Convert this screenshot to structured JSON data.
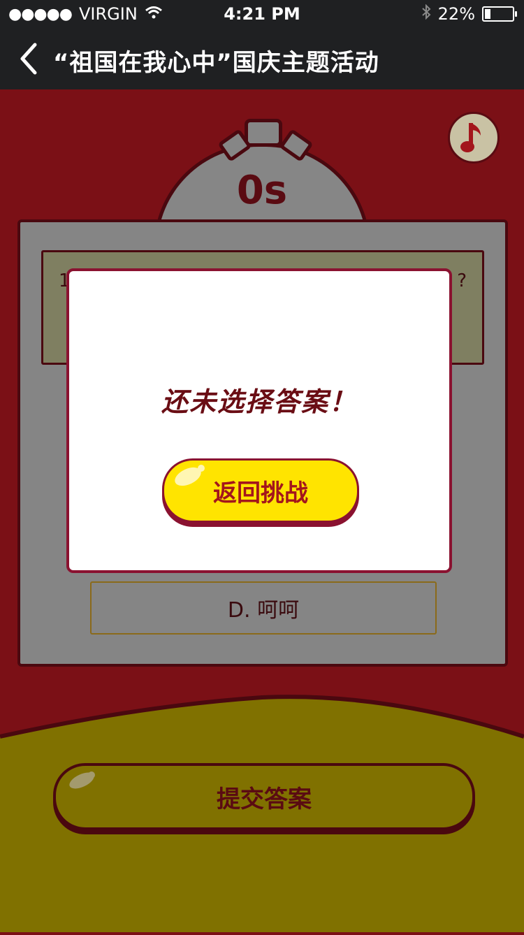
{
  "status_bar": {
    "carrier": "VIRGIN",
    "time": "4:21 PM",
    "battery_text": "22%",
    "battery_level": 0.22
  },
  "nav": {
    "title": "“祖国在我心中”国庆主题活动",
    "back_icon": "chevron-left-icon"
  },
  "timer": {
    "value": "0s"
  },
  "question": {
    "text_visible_prefix": "1",
    "text_visible_suffix": "?"
  },
  "options": [
    {
      "label": "D. 呵呵"
    }
  ],
  "submit": {
    "label": "提交答案"
  },
  "modal": {
    "message": "还未选择答案！",
    "button_label": "返回挑战"
  },
  "colors": {
    "background_red": "#7b1016",
    "accent_yellow": "#ffe400",
    "dark_maroon": "#4a080f",
    "modal_border": "#8a1230"
  }
}
